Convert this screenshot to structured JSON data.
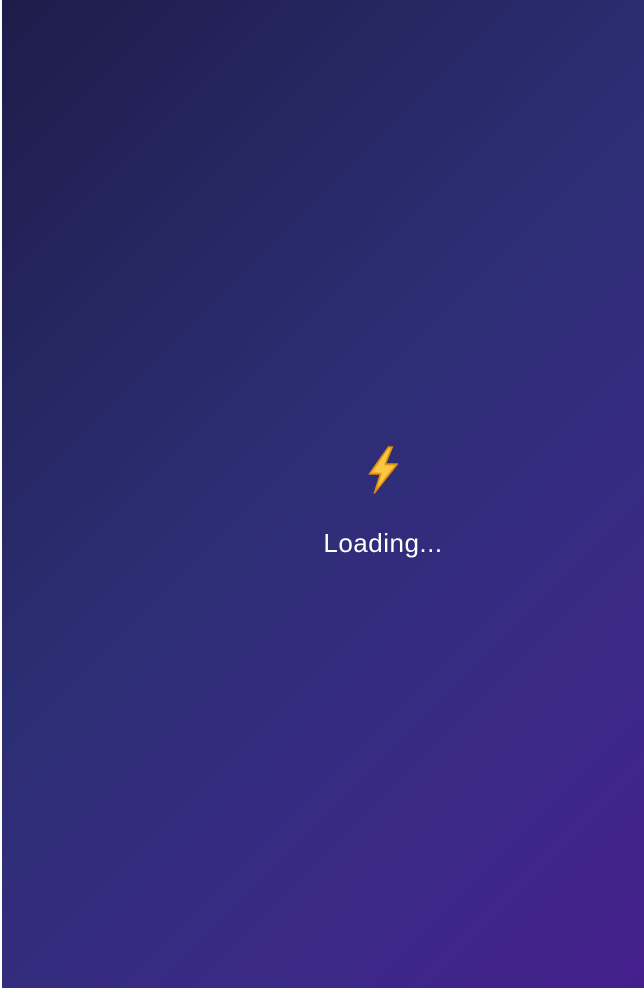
{
  "loader": {
    "icon": "lightning-bolt-icon",
    "text": "Loading..."
  },
  "colors": {
    "background_start": "#1e1c4a",
    "background_mid": "#2c2e74",
    "background_end": "#45208c",
    "bolt_fill": "#f7b52b",
    "bolt_outline": "#d98a12",
    "text": "#ffffff"
  }
}
